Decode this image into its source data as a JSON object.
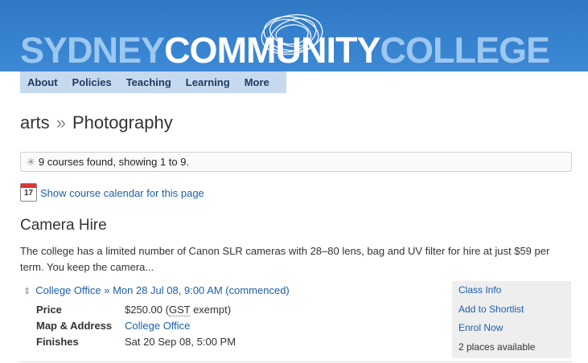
{
  "banner": {
    "logo_part1": "SYDNEY",
    "logo_part2": "COMMUNITY",
    "logo_part3": "COLLEGE"
  },
  "nav": {
    "items": [
      {
        "label": "About"
      },
      {
        "label": "Policies"
      },
      {
        "label": "Teaching"
      },
      {
        "label": "Learning"
      },
      {
        "label": "More"
      }
    ]
  },
  "breadcrumb": {
    "parent": "arts",
    "separator": "»",
    "current": "Photography"
  },
  "results": {
    "text": "9 courses found, showing 1 to 9."
  },
  "calendar": {
    "day": "17",
    "link": "Show course calendar for this page"
  },
  "course": {
    "title": "Camera Hire",
    "description": "The college has a limited number of Canon SLR cameras with 28–80 lens, bag and UV filter for hire at just $59 per term. You keep the camera...",
    "session_link": "College Office » Mon 28 Jul 08, 9:00 AM (commenced)",
    "details": {
      "price_label": "Price",
      "price_value": "$250.00",
      "price_note": "GST",
      "price_suffix": " exempt)",
      "map_label": "Map & Address",
      "map_value": "College Office",
      "finishes_label": "Finishes",
      "finishes_value": "Sat 20 Sep 08, 5:00 PM"
    },
    "actions": {
      "class_info": "Class Info",
      "add_shortlist": "Add to Shortlist",
      "enrol": "Enrol Now",
      "places": "2 places available"
    }
  },
  "colors": {
    "banner": "#2f78c4",
    "nav_bg": "#c7d9ee",
    "link": "#1c5fa8"
  }
}
